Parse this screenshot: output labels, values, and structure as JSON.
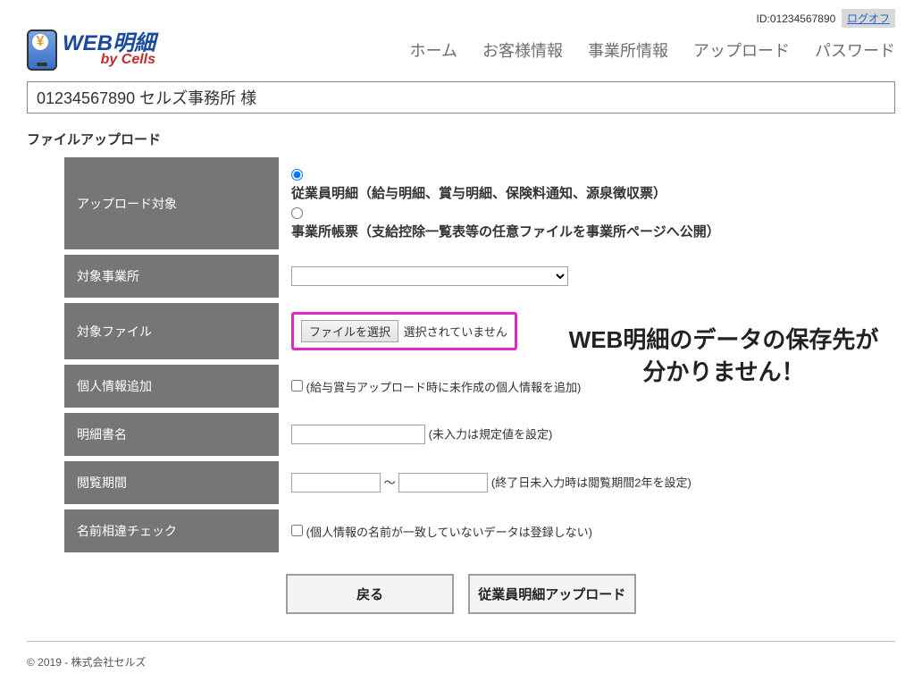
{
  "header": {
    "id_prefix": "ID:",
    "id_value": "01234567890",
    "logoff": "ログオフ",
    "logo_web": "WEB",
    "logo_meisai": "明細",
    "logo_by": "by Cells",
    "nav": [
      "ホーム",
      "お客様情報",
      "事業所情報",
      "アップロード",
      "パスワード"
    ]
  },
  "office_line": "01234567890 セルズ事務所 様",
  "page_title": "ファイルアップロード",
  "form": {
    "upload_target_label": "アップロード対象",
    "radio1": "従業員明細（給与明細、賞与明細、保険料通知、源泉徴収票）",
    "radio2": "事業所帳票（支給控除一覧表等の任意ファイルを事業所ページへ公開）",
    "target_office_label": "対象事業所",
    "target_file_label": "対象ファイル",
    "file_btn": "ファイルを選択",
    "file_none": "選択されていません",
    "personal_add_label": "個人情報追加",
    "personal_add_text": "(給与賞与アップロード時に未作成の個人情報を追加)",
    "doc_name_label": "明細書名",
    "doc_name_hint": "(未入力は規定値を設定)",
    "period_label": "閲覧期間",
    "period_tilde": "～",
    "period_hint": "(終了日未入力時は閲覧期間2年を設定)",
    "name_check_label": "名前相違チェック",
    "name_check_text": "(個人情報の名前が一致していないデータは登録しない)"
  },
  "buttons": {
    "back": "戻る",
    "upload": "従業員明細アップロード"
  },
  "footer": "© 2019 - 株式会社セルズ",
  "overlay": {
    "line1": "WEB明細のデータの保存先が",
    "line2": "分かりません！"
  }
}
